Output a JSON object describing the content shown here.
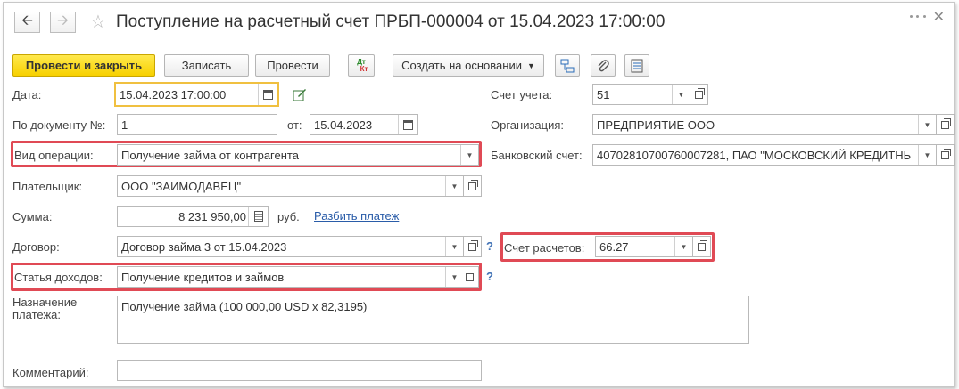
{
  "window": {
    "title": "Поступление на расчетный счет ПРБП-000004 от 15.04.2023 17:00:00",
    "back_icon": "arrow-left-icon",
    "forward_icon": "arrow-right-icon",
    "favorite_icon": "star-icon"
  },
  "toolbar": {
    "post_and_close": "Провести и закрыть",
    "save": "Записать",
    "post": "Провести",
    "dtkt_d": "Дт",
    "dtkt_k": "Кт",
    "create_based_on": "Создать на основании",
    "structure_icon": "structure-icon",
    "attach_icon": "paperclip-icon",
    "report_icon": "report-icon"
  },
  "form": {
    "date_label": "Дата:",
    "date_value": "15.04.2023 17:00:00",
    "doc_number_label": "По документу №:",
    "doc_number_value": "1",
    "doc_from_label": "от:",
    "doc_date_value": "15.04.2023",
    "operation_label": "Вид операции:",
    "operation_value": "Получение займа от контрагента",
    "payer_label": "Плательщик:",
    "payer_value": "ООО \"ЗАИМОДАВЕЦ\"",
    "amount_label": "Сумма:",
    "amount_value": "8 231 950,00",
    "currency": "руб.",
    "split_payment": "Разбить платеж",
    "contract_label": "Договор:",
    "contract_value": "Договор займа 3 от 15.04.2023",
    "income_item_label": "Статья доходов:",
    "income_item_value": "Получение кредитов и займов",
    "purpose_label": "Назначение платежа:",
    "purpose_value": "Получение займа (100 000,00 USD x 82,3195)",
    "comment_label": "Комментарий:",
    "comment_value": "",
    "help": "?",
    "account_label": "Счет учета:",
    "account_value": "51",
    "org_label": "Организация:",
    "org_value": "ПРЕДПРИЯТИЕ ООО",
    "bank_account_label": "Банковский счет:",
    "bank_account_value": "40702810700760007281, ПАО \"МОСКОВСКИЙ КРЕДИТНЬ",
    "settlement_account_label": "Счет расчетов:",
    "settlement_account_value": "66.27"
  },
  "colors": {
    "highlight": "#e04a55",
    "primary_button": "#f7d000",
    "link": "#2a5ca8"
  }
}
